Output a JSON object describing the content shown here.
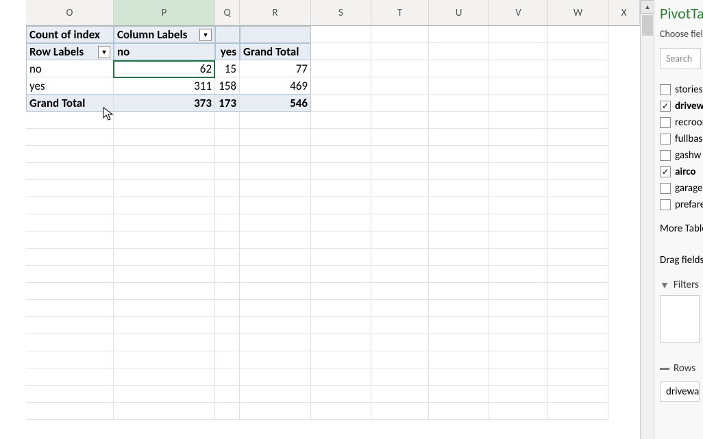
{
  "columns": {
    "O": "O",
    "P": "P",
    "Q": "Q",
    "R": "R",
    "S": "S",
    "T": "T",
    "U": "U",
    "V": "V",
    "W": "W",
    "X": "X"
  },
  "pivot": {
    "corner1": "Count of index",
    "corner2": "Column Labels",
    "row_labels_header": "Row Labels",
    "col_headers": [
      "no",
      "yes",
      "Grand Total"
    ],
    "rows": [
      {
        "label": "no",
        "no": "62",
        "yes": "15",
        "total": "77"
      },
      {
        "label": "yes",
        "no": "311",
        "yes": "158",
        "total": "469"
      }
    ],
    "grand_total": {
      "label": "Grand Total",
      "no": "373",
      "yes": "173",
      "total": "546"
    }
  },
  "sidebar": {
    "title": "PivotTable Fields",
    "subtitle": "Choose fields to add to report:",
    "search_placeholder": "Search",
    "fields": [
      {
        "name": "stories",
        "checked": false,
        "bold": false
      },
      {
        "name": "driveway",
        "checked": true,
        "bold": true
      },
      {
        "name": "recroom",
        "checked": false,
        "bold": false
      },
      {
        "name": "fullbase",
        "checked": false,
        "bold": false
      },
      {
        "name": "gashw",
        "checked": false,
        "bold": false
      },
      {
        "name": "airco",
        "checked": true,
        "bold": true
      },
      {
        "name": "garagepl",
        "checked": false,
        "bold": false
      },
      {
        "name": "prefarea",
        "checked": false,
        "bold": false
      }
    ],
    "more_tables": "More Tables...",
    "drag_label": "Drag fields between areas below:",
    "filters_label": "Filters",
    "rows_label": "Rows",
    "row_field": "driveway"
  }
}
